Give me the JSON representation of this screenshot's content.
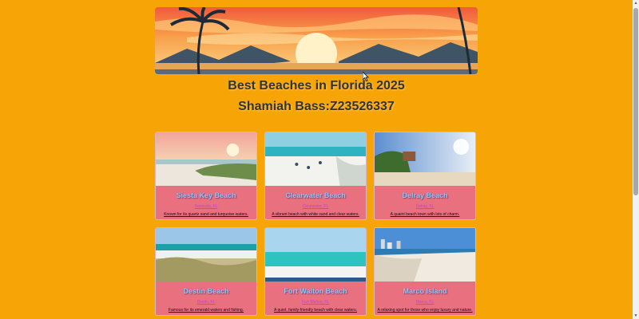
{
  "page": {
    "title": "Best Beaches in Florida 2025",
    "subtitle": "Shamiah Bass:Z23526337",
    "background": "#F7A407",
    "card_color": "#E8707F"
  },
  "banner": {
    "image": "sunset-palm-banner"
  },
  "cards": [
    {
      "name": "Siesta Key Beach",
      "location": "Sarasota, FL",
      "description": "Known for its quartz sand and turquoise waters.",
      "image": "siesta-key-photo"
    },
    {
      "name": "Clearwater Beach",
      "location": "Clearwater, FL",
      "description": "A vibrant beach with white sand and clear waters.",
      "image": "clearwater-photo"
    },
    {
      "name": "Delray Beach",
      "location": "Delray, FL",
      "description": "A quaint beach town with lots of charm.",
      "image": "delray-photo"
    },
    {
      "name": "Destin Beach",
      "location": "Destin, FL",
      "description": "Famous for its emerald waters and fishing.",
      "image": "destin-photo"
    },
    {
      "name": "Fort Walton Beach",
      "location": "Fort Walton, FL",
      "description": "A quiet, family-friendly beach with clear waters.",
      "image": "fort-walton-photo"
    },
    {
      "name": "Marco Island",
      "location": "Marco, FL",
      "description": "A relaxing spot for those who enjoy luxury and nature.",
      "image": "marco-island-photo"
    }
  ]
}
